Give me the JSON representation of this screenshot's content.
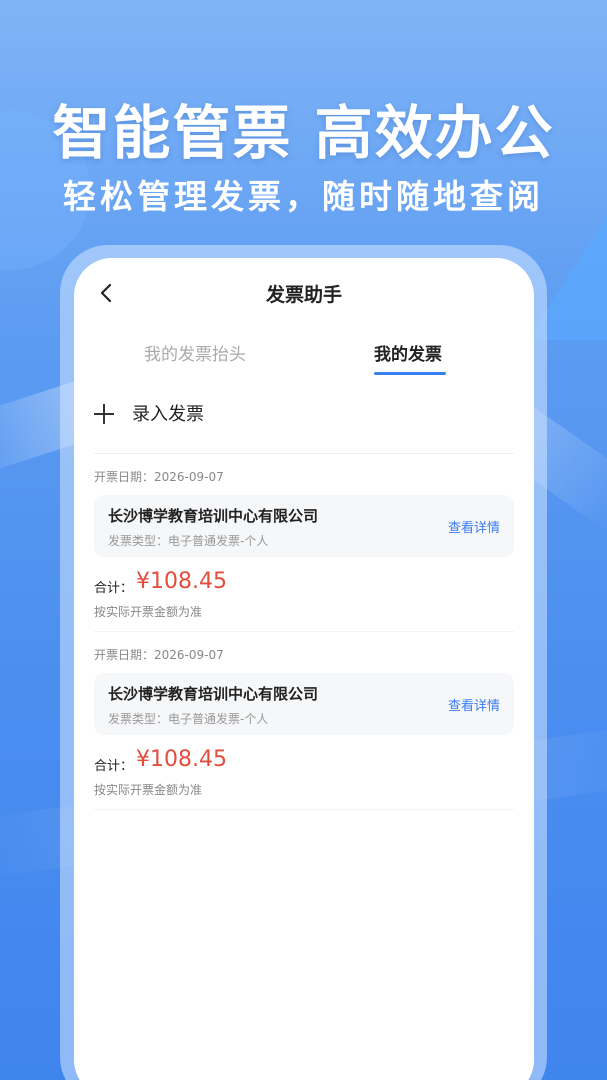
{
  "hero": {
    "title": "智能管票 高效办公",
    "subtitle": "轻松管理发票，随时随地查阅"
  },
  "header": {
    "title": "发票助手"
  },
  "tabs": [
    {
      "label": "我的发票抬头",
      "active": false
    },
    {
      "label": "我的发票",
      "active": true
    }
  ],
  "actions": {
    "add_invoice_label": "录入发票"
  },
  "invoices": [
    {
      "date": "开票日期：2026-09-07",
      "company": "长沙博学教育培训中心有限公司",
      "type": "发票类型：电子普通发票-个人",
      "detail_label": "查看详情",
      "total_label": "合计：",
      "amount": "¥108.45",
      "note": "按实际开票金额为准"
    },
    {
      "date": "开票日期：2026-09-07",
      "company": "长沙博学教育培训中心有限公司",
      "type": "发票类型：电子普通发票-个人",
      "detail_label": "查看详情",
      "total_label": "合计：",
      "amount": "¥108.45",
      "note": "按实际开票金额为准"
    }
  ],
  "colors": {
    "accent": "#3a7ef0",
    "price": "#e24d3d",
    "background": "#5d9cf2"
  },
  "icons": {
    "back": "chevron-left-icon",
    "add": "plus-icon"
  }
}
